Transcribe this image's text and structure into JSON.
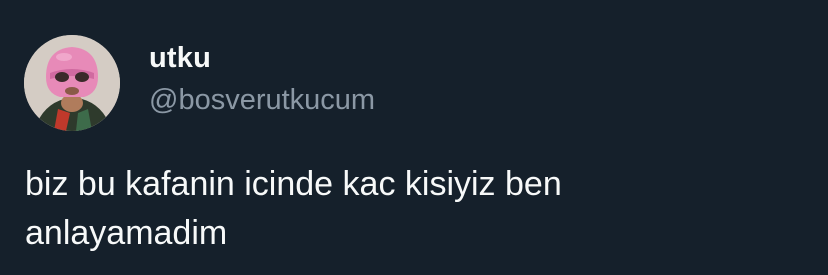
{
  "tweet": {
    "author": {
      "display_name": "utku",
      "handle": "@bosverutkucum",
      "avatar_icon": "avatar-photo-pink-mask"
    },
    "text_lines": [
      "biz bu kafanin icinde kac kisiyiz ben",
      "anlayamadim"
    ]
  },
  "colors": {
    "background": "#15202b",
    "primary_text": "#f7f9f9",
    "secondary_text": "#8b98a5"
  }
}
